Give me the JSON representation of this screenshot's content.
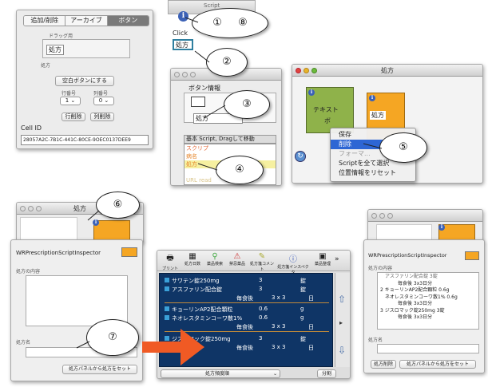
{
  "panel1": {
    "tabs": [
      "追加/削除",
      "アーカイブ",
      "ボタン"
    ],
    "drag_caption": "ドラッグ用",
    "drag_label": "処方",
    "label_caption": "処方",
    "blank_button": "空白ボタンにする",
    "row_caption": "行番号",
    "col_caption": "列番号",
    "row_value": "1",
    "col_value": "0",
    "row_delete": "行削除",
    "col_delete": "列削除",
    "cell_id_label": "Cell ID",
    "cell_id_value": "28057A2C-7B1C-441C-80CE-9OEC0137DEE9"
  },
  "top_strip_title": "Script",
  "click_box": {
    "line1": "Click",
    "line2": "処方"
  },
  "button_info": {
    "title": "ボタン情報",
    "name": "処方",
    "list_header": "基本 Script, Dragして移動",
    "list_items": [
      "スクリプ",
      "病名",
      "処方",
      "",
      "URL read"
    ]
  },
  "canvas_win": {
    "title": "処方",
    "green_text": "テキスト",
    "green_sub": "ボ",
    "orange_text": "処方"
  },
  "context_menu": [
    "保存",
    "削除",
    "フォーマ...",
    "Scriptを全て選択",
    "位置情報をリセット"
  ],
  "callouts": {
    "c1": "①",
    "c8": "⑧",
    "c2": "②",
    "c3": "③",
    "c4": "④",
    "c5": "⑤",
    "c6": "⑥",
    "c7": "⑦"
  },
  "small_win_title": "処方",
  "inspector_left": {
    "title": "WRPrescriptionScriptInspector",
    "content_label": "処方の内容",
    "name_label": "処方名",
    "set_button": "処方パネルから処方をセット"
  },
  "prescription": {
    "toolbar": [
      "プリント",
      "処方日数",
      "薬品検索",
      "禁忌薬品",
      "処方箋コメント",
      "処方箋インスペクタ",
      "薬品整理"
    ],
    "rows": [
      {
        "name": "サワテン錠250mg",
        "qty": "3",
        "unit": "錠"
      },
      {
        "name": "アスファリン配合錠",
        "qty": "3",
        "unit": "錠"
      },
      {
        "name": "毎食後",
        "qty": "3 x 3",
        "unit": "日"
      },
      {
        "name": "キョーリンAP2配合顆粒",
        "qty": "0.6",
        "unit": "g"
      },
      {
        "name": "ネオレスタミンコーワ散1%",
        "qty": "0.6",
        "unit": "g"
      },
      {
        "name": "毎食後",
        "qty": "3 x 3",
        "unit": "日"
      },
      {
        "name": "ジスロマック錠250mg",
        "qty": "3",
        "unit": "錠"
      },
      {
        "name": "毎食後",
        "qty": "3 x 3",
        "unit": "日"
      }
    ],
    "footer_select": "処方頻度順",
    "footer_button": "分割"
  },
  "inspector_right": {
    "title": "WRPrescriptionScriptInspector",
    "content_label": "処方の内容",
    "lines": [
      "アスファリン配合錠 3錠",
      "毎食後 3x3日分",
      "2 キョーリンAP2配合顆粒 0.6g",
      "ネオレスタミンコーワ散1% 0.6g",
      "毎食後 3x3日分",
      "3 ジスロマック錠250mg 3錠",
      "毎食後 3x3日分"
    ],
    "name_label": "処方名",
    "btn_delete": "処方削除",
    "btn_set": "処方パネルから処方をセット"
  },
  "colors": {
    "accent_orange": "#f5a623",
    "green": "#8fb24a",
    "navy": "#0f3566",
    "arrow": "#f05a24"
  }
}
